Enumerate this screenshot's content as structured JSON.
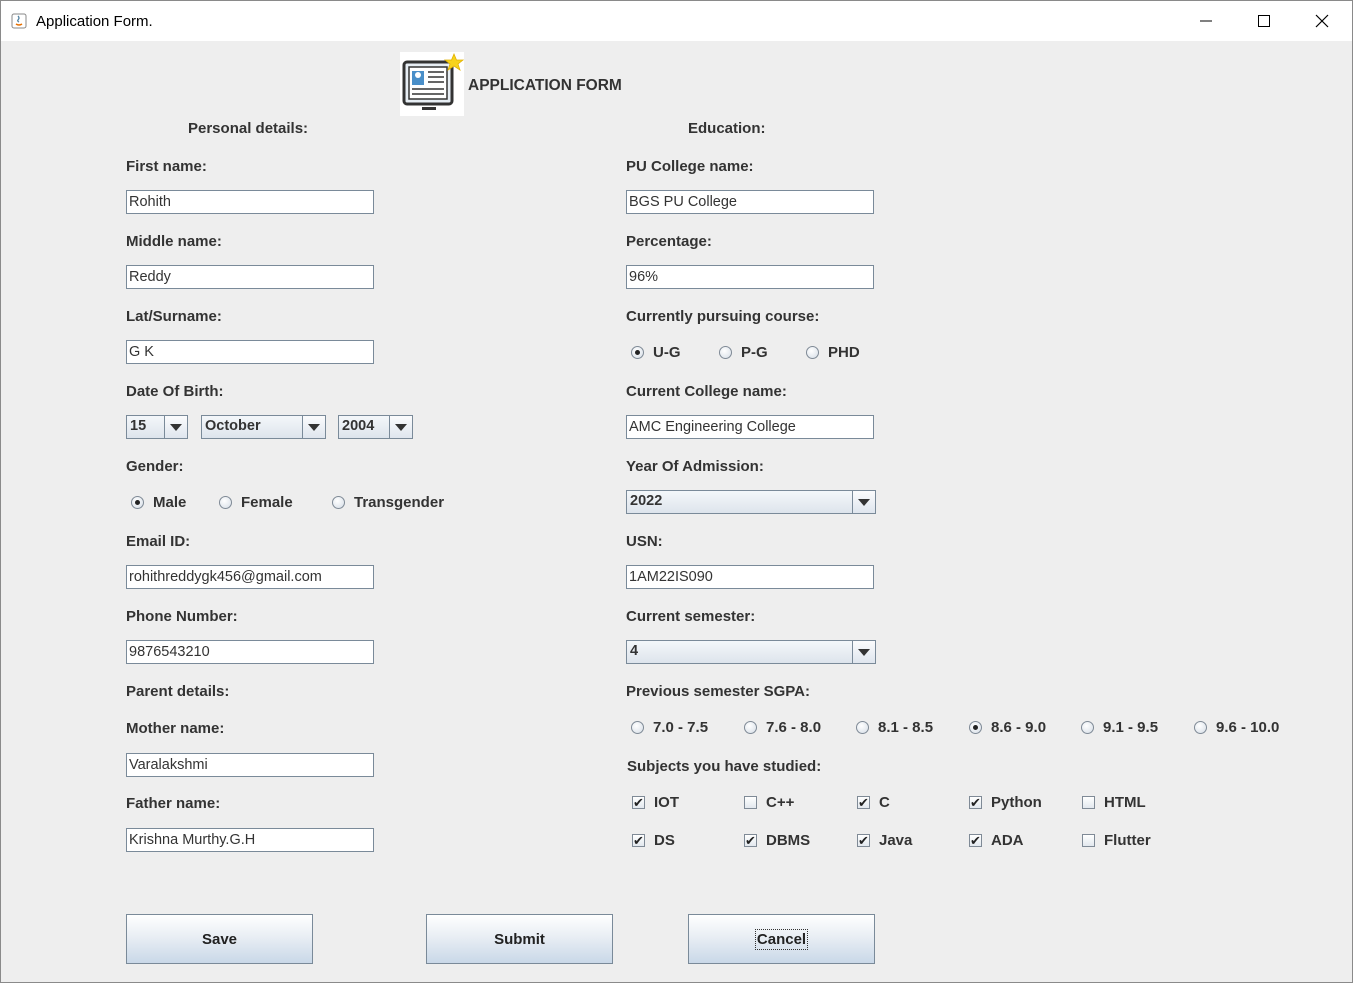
{
  "window": {
    "title": "Application Form.",
    "minimize_icon": "minimize-icon",
    "maximize_icon": "maximize-icon",
    "close_icon": "close-icon"
  },
  "header": {
    "title": "APPLICATION FORM",
    "logo_icon": "application-form-icon"
  },
  "personal": {
    "heading": "Personal details:",
    "first_name_label": "First name:",
    "first_name": "Rohith",
    "middle_name_label": "Middle name:",
    "middle_name": "Reddy",
    "last_name_label": "Lat/Surname:",
    "last_name": "G K",
    "dob_label": "Date Of Birth:",
    "dob_day": "15",
    "dob_month": "October",
    "dob_year": "2004",
    "gender_label": "Gender:",
    "gender_options": [
      "Male",
      "Female",
      "Transgender"
    ],
    "gender_selected": "Male",
    "email_label": "Email ID:",
    "email": "rohithreddygk456@gmail.com",
    "phone_label": "Phone Number:",
    "phone": "9876543210",
    "parent_heading": "Parent details:",
    "mother_label": "Mother name:",
    "mother": "Varalakshmi",
    "father_label": "Father name:",
    "father": "Krishna Murthy.G.H"
  },
  "education": {
    "heading": "Education:",
    "pu_college_label": "PU College name:",
    "pu_college": "BGS PU College",
    "percentage_label": "Percentage:",
    "percentage": "96%",
    "course_label": "Currently pursuing course:",
    "course_options": [
      "U-G",
      "P-G",
      "PHD"
    ],
    "course_selected": "U-G",
    "college_label": "Current College name:",
    "college": "AMC Engineering College",
    "admission_label": "Year Of Admission:",
    "admission_year": "2022",
    "usn_label": "USN:",
    "usn": "1AM22IS090",
    "semester_label": "Current semester:",
    "semester": "4",
    "sgpa_label": "Previous semester SGPA:",
    "sgpa_options": [
      "7.0 - 7.5",
      "7.6 - 8.0",
      "8.1 - 8.5",
      "8.6 - 9.0",
      "9.1 - 9.5",
      "9.6 - 10.0"
    ],
    "sgpa_selected": "8.6 - 9.0",
    "subjects_label": "Subjects you have studied:",
    "subjects": [
      {
        "name": "IOT",
        "checked": true
      },
      {
        "name": "C++",
        "checked": false
      },
      {
        "name": "C",
        "checked": true
      },
      {
        "name": "Python",
        "checked": true
      },
      {
        "name": "HTML",
        "checked": false
      },
      {
        "name": "DS",
        "checked": true
      },
      {
        "name": "DBMS",
        "checked": true
      },
      {
        "name": "Java",
        "checked": true
      },
      {
        "name": "ADA",
        "checked": true
      },
      {
        "name": "Flutter",
        "checked": false
      }
    ]
  },
  "buttons": {
    "save": "Save",
    "submit": "Submit",
    "cancel": "Cancel"
  }
}
